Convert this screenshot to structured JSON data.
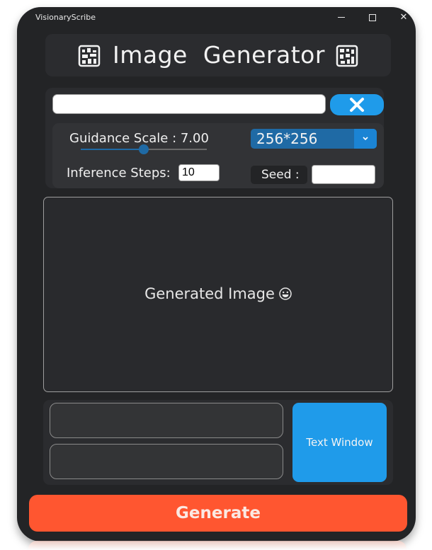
{
  "window": {
    "app_title": "VisionaryScribe"
  },
  "header": {
    "title": "Image  Generator",
    "icon_name": "art-frame-icon"
  },
  "prompt": {
    "value": "",
    "placeholder": ""
  },
  "clear_button": {
    "icon": "close-icon"
  },
  "guidance": {
    "label": "Guidance Scale : 7.00",
    "value": 7.0,
    "slider_fraction": 0.5
  },
  "size_select": {
    "value": "256*256",
    "arrow_icon": "chevron-down-icon"
  },
  "steps": {
    "label": "Inference Steps:",
    "value": "10"
  },
  "seed": {
    "label": "Seed :",
    "value": ""
  },
  "image_area": {
    "label": "Generated Image",
    "emoji_icon": "grinning-face-icon"
  },
  "bottom": {
    "text_window_label": "Text Window"
  },
  "generate": {
    "label": "Generate"
  },
  "colors": {
    "window_bg": "#232426",
    "panel_bg": "#2b2c2f",
    "accent_blue": "#1f9bea",
    "select_blue": "#1f6aa5",
    "generate_orange": "#ff5630"
  }
}
